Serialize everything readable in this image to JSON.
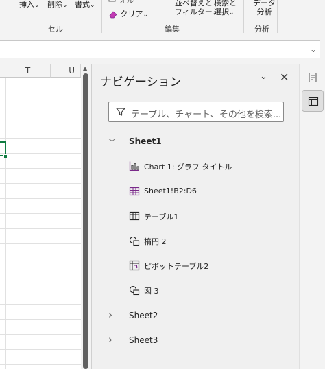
{
  "ribbon": {
    "cells_group": {
      "insert_label": "挿入",
      "delete_label": "削除",
      "format_label": "書式",
      "group_label": "セル",
      "chevron": "⌄"
    },
    "editing_group": {
      "partial_top_label": "ォル",
      "clear_label": "クリア",
      "sort_filter_line1": "並べ替えと",
      "sort_filter_line2": "フィルター",
      "find_select_line1": "検索と",
      "find_select_line2": "選択",
      "group_label": "編集",
      "chevron": "⌄"
    },
    "analysis_group": {
      "data_analysis_line1": "データ",
      "data_analysis_line2": "分析",
      "group_label": "分析"
    }
  },
  "formula_bar": {
    "expand_icon": "chevron-down-icon",
    "expand_glyph": "⌄"
  },
  "grid": {
    "columns": [
      "T",
      "U"
    ]
  },
  "navigation": {
    "title": "ナビゲーション",
    "collapse_glyph": "⌄",
    "close_glyph": "✕",
    "search_placeholder": "テーブル、チャート、その他を検索...",
    "sheets": [
      {
        "name": "Sheet1",
        "expanded": true,
        "twisty": "﹀",
        "items": [
          {
            "label": "Chart 1: グラフ タイトル",
            "icon": "chart-icon"
          },
          {
            "label": "Sheet1!B2:D6",
            "icon": "range-icon"
          },
          {
            "label": "テーブル1",
            "icon": "table-icon"
          },
          {
            "label": "楕円 2",
            "icon": "shape-icon"
          },
          {
            "label": "ピボットテーブル2",
            "icon": "pivot-table-icon"
          },
          {
            "label": "図 3",
            "icon": "shape-icon"
          }
        ]
      },
      {
        "name": "Sheet2",
        "expanded": false,
        "twisty": "›"
      },
      {
        "name": "Sheet3",
        "expanded": false,
        "twisty": "›"
      }
    ]
  },
  "colors": {
    "accent_green": "#107c41",
    "icon_purple": "#7a2a8a",
    "pane_bg": "#f0f0f0"
  }
}
